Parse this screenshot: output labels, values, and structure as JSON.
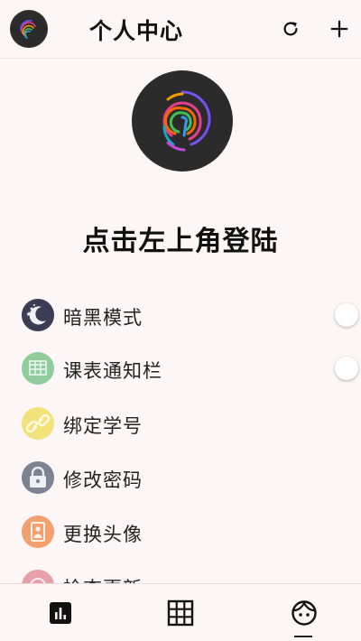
{
  "header": {
    "title": "个人中心",
    "avatar_icon": "fingerprint-logo-icon",
    "refresh_icon": "refresh-icon",
    "add_icon": "plus-icon"
  },
  "profile": {
    "avatar_icon": "fingerprint-logo-icon",
    "login_prompt": "点击左上角登陆"
  },
  "menu": {
    "items": [
      {
        "label": "暗黑模式",
        "icon": "moon-night-icon",
        "icon_color": "#3b3d55",
        "has_toggle": true,
        "toggle_on": false
      },
      {
        "label": "课表通知栏",
        "icon": "timetable-icon",
        "icon_color": "#8fcb9b",
        "has_toggle": true,
        "toggle_on": false
      },
      {
        "label": "绑定学号",
        "icon": "link-icon",
        "icon_color": "#f3e27a",
        "has_toggle": false
      },
      {
        "label": "修改密码",
        "icon": "lock-icon",
        "icon_color": "#7d8392",
        "has_toggle": false
      },
      {
        "label": "更换头像",
        "icon": "portrait-icon",
        "icon_color": "#f3a070",
        "has_toggle": false
      },
      {
        "label": "检查更新",
        "icon": "update-icon",
        "icon_color": "#e7a0a8",
        "has_toggle": false
      }
    ]
  },
  "bottom_nav": {
    "tabs": [
      {
        "name": "stats",
        "icon": "bar-chart-icon"
      },
      {
        "name": "schedule",
        "icon": "grid-table-icon"
      },
      {
        "name": "profile",
        "icon": "face-icon",
        "active": true
      }
    ]
  },
  "colors": {
    "background": "#fdf6f6",
    "text": "#111111",
    "avatar_bg": "#2b2b2b"
  }
}
